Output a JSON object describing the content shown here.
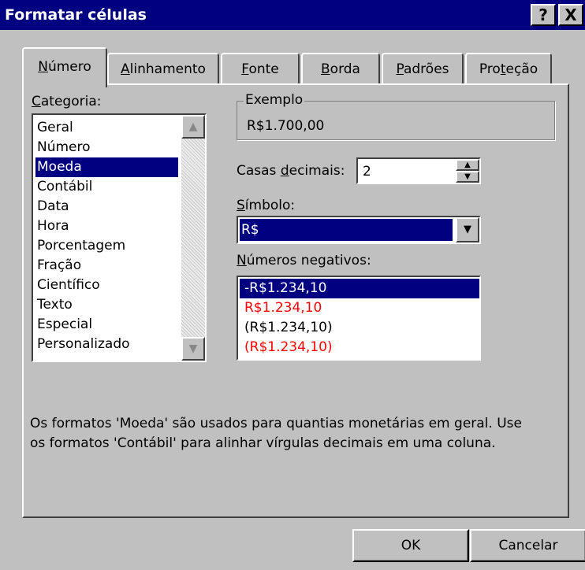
{
  "window": {
    "title": "Formatar células",
    "help_glyph": "?",
    "close_glyph": "X"
  },
  "tabs": [
    {
      "pre": "",
      "u": "N",
      "post": "úmero"
    },
    {
      "pre": "",
      "u": "A",
      "post": "linhamento"
    },
    {
      "pre": "",
      "u": "F",
      "post": "onte"
    },
    {
      "pre": "",
      "u": "B",
      "post": "orda"
    },
    {
      "pre": "",
      "u": "P",
      "post": "adrões"
    },
    {
      "pre": "Pro",
      "u": "t",
      "post": "eção"
    }
  ],
  "category": {
    "label_u": "C",
    "label_rest": "ategoria:",
    "items": [
      "Geral",
      "Número",
      "Moeda",
      "Contábil",
      "Data",
      "Hora",
      "Porcentagem",
      "Fração",
      "Científico",
      "Texto",
      "Especial",
      "Personalizado"
    ],
    "selected": "Moeda"
  },
  "example": {
    "legend": "Exemplo",
    "value": "R$1.700,00"
  },
  "decimals": {
    "label_pre": "Casas ",
    "label_u": "d",
    "label_post": "ecimais:",
    "value": "2"
  },
  "symbol": {
    "label_u": "S",
    "label_rest": "ímbolo:",
    "value": "R$"
  },
  "negatives": {
    "label_u": "N",
    "label_rest": "úmeros negativos:",
    "items": [
      "-R$1.234,10",
      "R$1.234,10",
      "(R$1.234,10)",
      "(R$1.234,10)"
    ]
  },
  "description_line1": "Os formatos 'Moeda' são usados para quantias monetárias em geral. Use",
  "description_line2": "os formatos 'Contábil' para alinhar vírgulas decimais em uma coluna.",
  "buttons": {
    "ok": "OK",
    "cancel": "Cancelar"
  },
  "colors": {
    "title_bar": "#000080",
    "face": "#c0c0c0",
    "selection": "#000080",
    "negative_red": "#ff0000"
  }
}
